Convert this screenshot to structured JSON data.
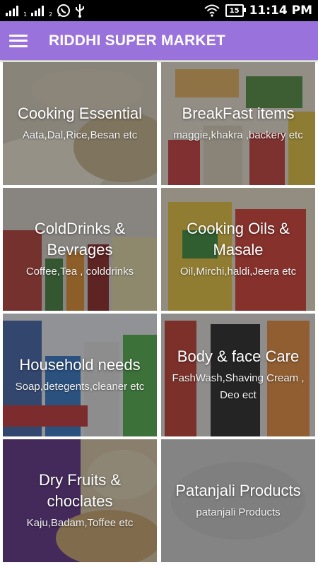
{
  "status_bar": {
    "sim1_label": "1",
    "sim2_label": "2",
    "battery": "15",
    "time": "11:14 PM"
  },
  "app_bar": {
    "title": "RIDDHI SUPER MARKET",
    "menu_icon": "hamburger-menu-icon"
  },
  "categories": [
    {
      "title": "Cooking Essential",
      "subtitle": "Aata,Dal,Rice,Besan etc",
      "color": "#c9b48a"
    },
    {
      "title": "BreakFast items",
      "subtitle": "maggie,khakra ,backery etc",
      "color": "#c8484a"
    },
    {
      "title": "ColdDrinks & Bevrages",
      "subtitle": "Coffee,Tea , colddrinks",
      "color": "#8b5a3a"
    },
    {
      "title": "Cooking Oils & Masale",
      "subtitle": "Oil,Mirchi,haldi,Jeera etc",
      "color": "#d98a2a"
    },
    {
      "title": "Household needs",
      "subtitle": "Soap,detegents,cleaner etc",
      "color": "#3d6fb0"
    },
    {
      "title": "Body & face Care",
      "subtitle": "FashWash,Shaving Cream , Deo ect",
      "color": "#6a6a6a"
    },
    {
      "title": "Dry Fruits & choclates",
      "subtitle": "Kaju,Badam,Toffee etc",
      "color": "#6b3a8e"
    },
    {
      "title": "Patanjali Products",
      "subtitle": "patanjali Products",
      "color": "#b8b8b8"
    }
  ]
}
